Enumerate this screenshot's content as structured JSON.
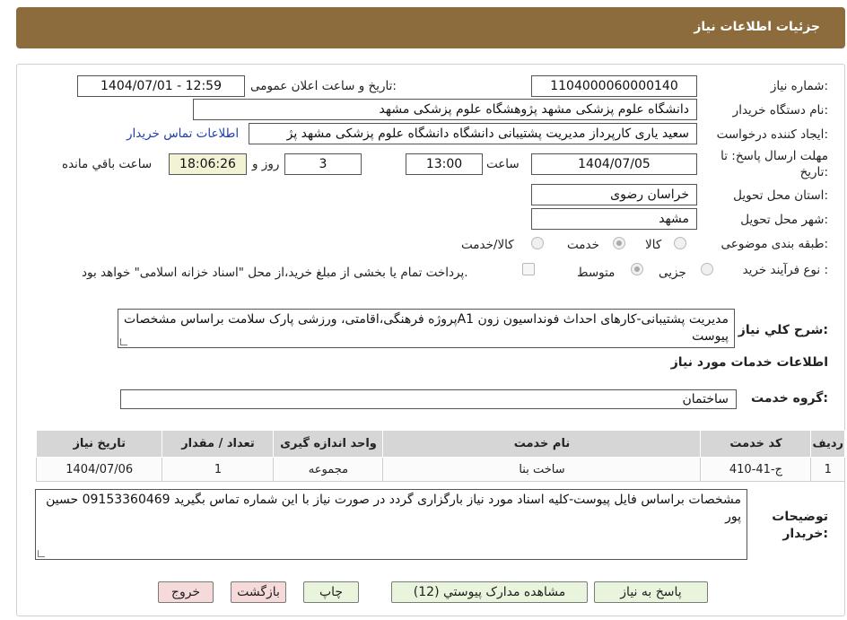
{
  "header": {
    "title": "جزئیات اطلاعات نیاز"
  },
  "form": {
    "need_number_label": "شماره نیاز:",
    "need_number": "1104000060000140",
    "announce_label": "تاریخ و ساعت اعلان عمومی:",
    "announce_value": "1404/07/01 - 12:59",
    "buyer_org_label": "نام دستگاه خریدار:",
    "buyer_org": "دانشگاه علوم پزشکی مشهد   پژوهشگاه علوم پزشکی مشهد",
    "requester_label": "ایجاد کننده درخواست:",
    "requester": "سعید یاری کارپرداز مدیریت پشتیبانی دانشگاه دانشگاه علوم پزشکی مشهد   پژ",
    "buyer_contact_link": "اطلاعات تماس خریدار",
    "deadline_label_1": "مهلت ارسال پاسخ: تا",
    "deadline_label_2": "تاریخ:",
    "deadline_date": "1404/07/05",
    "time_label": "ساعت",
    "deadline_time": "13:00",
    "days_value": "3",
    "days_label": "روز و",
    "remaining_time": "18:06:26",
    "remaining_label": "ساعت باقي مانده",
    "province_label": "استان محل تحویل:",
    "province": "خراسان رضوی",
    "city_label": "شهر محل تحویل:",
    "city": "مشهد",
    "category_label": "طبقه بندی موضوعی:",
    "category_options": [
      "کالا",
      "خدمت",
      "کالا/خدمت"
    ],
    "category_selected": "خدمت",
    "process_label": "نوع فرآیند خرید :",
    "process_options": [
      "جزیی",
      "متوسط"
    ],
    "process_selected": "متوسط",
    "payment_note": "پرداخت تمام یا بخشی از مبلغ خرید،از محل \"اسناد خزانه اسلامی\" خواهد بود."
  },
  "summary": {
    "label": "شرح کلي نياز:",
    "text": "مدیریت پشتیبانی-کارهای احداث فونداسیون زون  A1پروژه فرهنگی،اقامتی، ورزشی پارک سلامت براساس مشخصات پیوست"
  },
  "services": {
    "section_title": "اطلاعات خدمات مورد نياز",
    "group_label": "گروه خدمت:",
    "group_value": "ساختمان",
    "columns": [
      "ردیف",
      "کد خدمت",
      "نام خدمت",
      "واحد اندازه گیری",
      "تعداد / مقدار",
      "تاریخ نیاز"
    ],
    "rows": [
      [
        "1",
        "ج-41-410",
        "ساخت بنا",
        "مجموعه",
        "1",
        "1404/07/06"
      ]
    ]
  },
  "buyer_notes": {
    "label_1": "توضیحات",
    "label_2": "خریدار:",
    "text": "مشخصات براساس فایل پیوست-کلیه اسناد مورد نیاز بارگزاری گردد در صورت نیاز با این شماره تماس بگیرید  09153360469 حسین پور"
  },
  "buttons": {
    "reply": "پاسخ به نیاز",
    "attachments": "مشاهده مدارک پیوستي (12)",
    "print": "چاپ",
    "back": "بازگشت",
    "exit": "خروج"
  },
  "colors": {
    "header_bg": "#8c6b3c",
    "link": "#1c3fae",
    "button_green": "#e8f4dc",
    "button_red": "#f6d9d9",
    "remaining_bg": "#f4f2d5"
  }
}
